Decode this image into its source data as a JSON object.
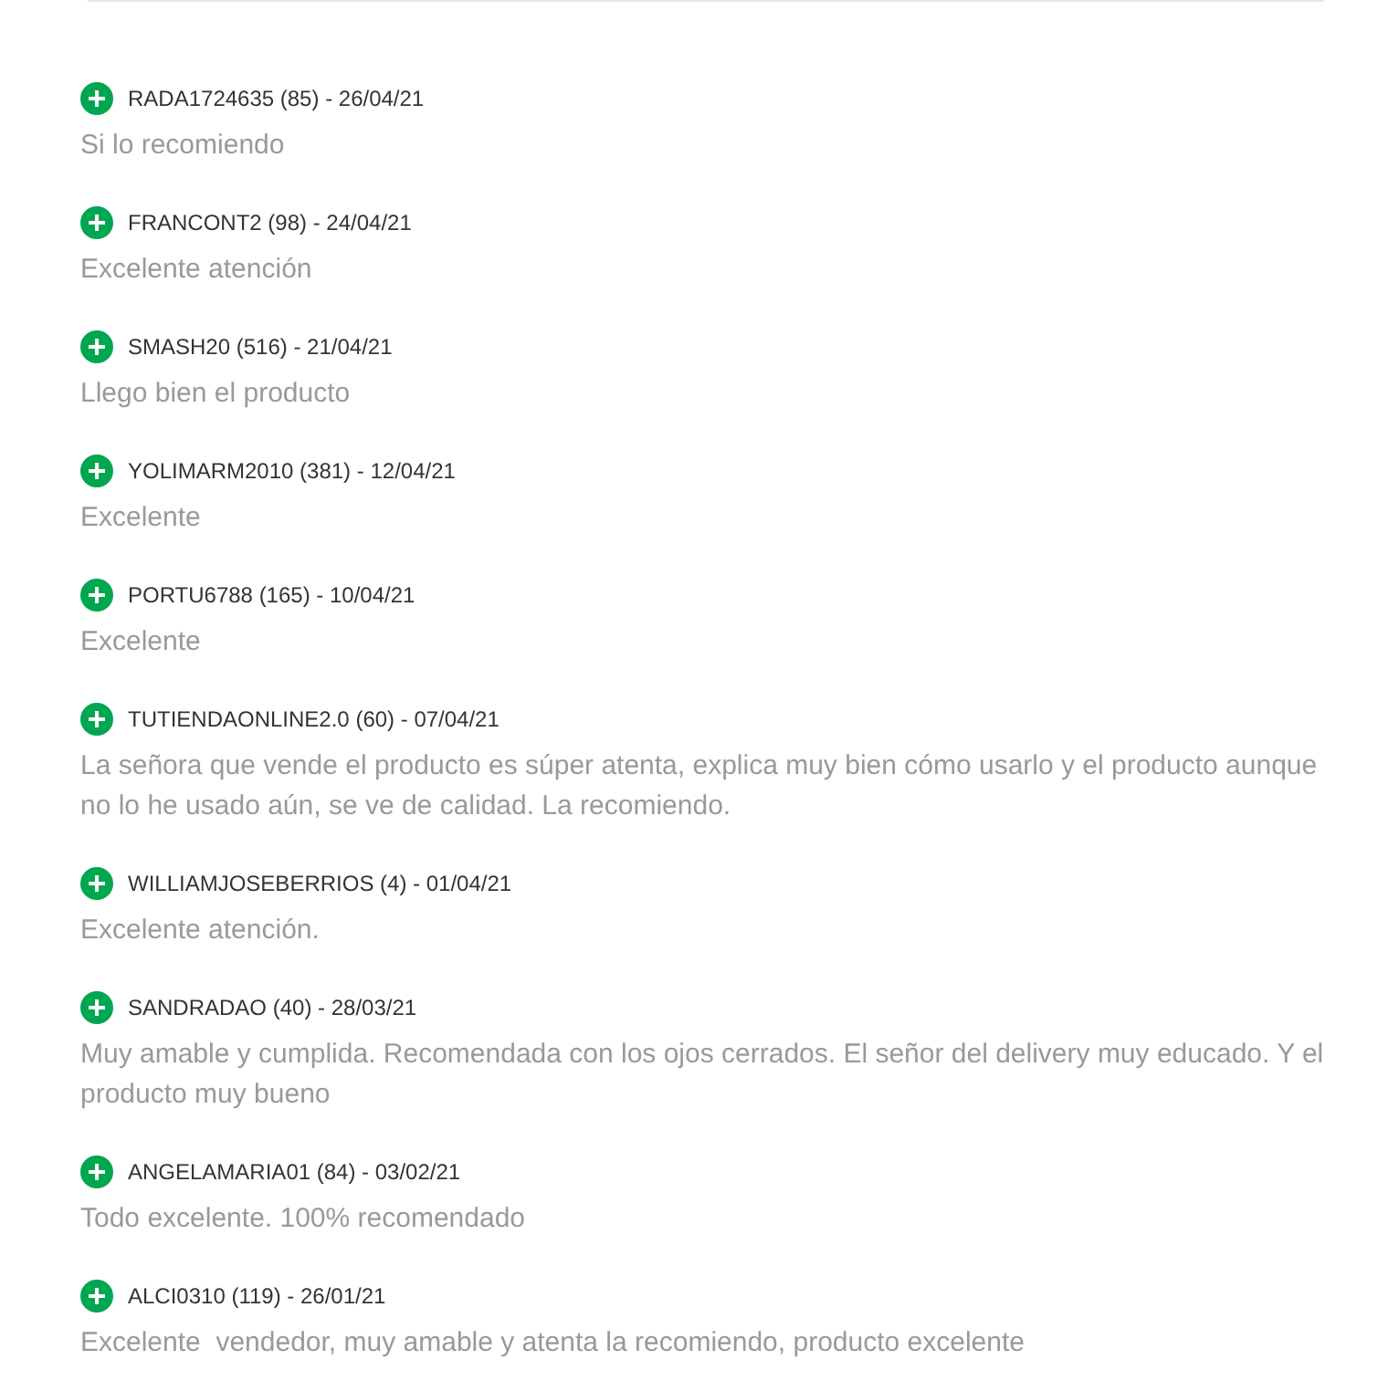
{
  "reviews": [
    {
      "header": "RADA1724635 (85) - 26/04/21",
      "text": "Si lo recomiendo"
    },
    {
      "header": "FRANCONT2 (98) - 24/04/21",
      "text": "Excelente atención"
    },
    {
      "header": "SMASH20 (516) - 21/04/21",
      "text": "Llego bien el producto"
    },
    {
      "header": "YOLIMARM2010 (381) - 12/04/21",
      "text": "Excelente"
    },
    {
      "header": "PORTU6788 (165) - 10/04/21",
      "text": "Excelente"
    },
    {
      "header": "TUTIENDAONLINE2.0 (60) - 07/04/21",
      "text": "La señora que vende el producto es súper atenta, explica muy bien cómo usarlo y el producto aunque no lo he usado aún, se ve de calidad. La recomiendo."
    },
    {
      "header": "WILLIAMJOSEBERRIOS (4) - 01/04/21",
      "text": "Excelente atención."
    },
    {
      "header": "SANDRADAO (40) - 28/03/21",
      "text": "Muy amable y cumplida. Recomendada con los ojos cerrados. El señor del delivery muy educado. Y el producto muy bueno"
    },
    {
      "header": "ANGELAMARIA01 (84) - 03/02/21",
      "text": "Todo excelente. 100% recomendado"
    },
    {
      "header": "ALCI0310 (119) - 26/01/21",
      "text": "Excelente  vendedor, muy amable y atenta la recomiendo, producto excelente"
    }
  ]
}
